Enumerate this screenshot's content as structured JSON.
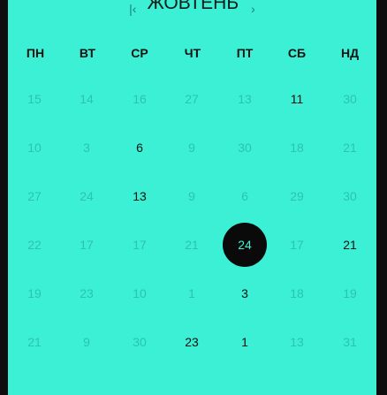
{
  "header": {
    "month_label": "ЖОВТЕНЬ",
    "prev_icon": "chevron-left-icon",
    "next_icon": "chevron-right-icon"
  },
  "weekdays": [
    "ПН",
    "ВТ",
    "СР",
    "ЧТ",
    "ПТ",
    "СБ",
    "НД"
  ],
  "colors": {
    "background": "#3bf0d4",
    "faded_text": "#2cc4ad",
    "marked_text": "#111111",
    "selected_bg": "#0a0a0a"
  },
  "weeks": [
    [
      {
        "d": "15",
        "s": "faded"
      },
      {
        "d": "14",
        "s": "faded"
      },
      {
        "d": "16",
        "s": "faded"
      },
      {
        "d": "27",
        "s": "faded"
      },
      {
        "d": "13",
        "s": "faded"
      },
      {
        "d": "11",
        "s": "marked"
      },
      {
        "d": "30",
        "s": "faded"
      }
    ],
    [
      {
        "d": "10",
        "s": "faded"
      },
      {
        "d": "3",
        "s": "faded"
      },
      {
        "d": "6",
        "s": "marked"
      },
      {
        "d": "9",
        "s": "faded"
      },
      {
        "d": "30",
        "s": "faded"
      },
      {
        "d": "18",
        "s": "faded"
      },
      {
        "d": "21",
        "s": "faded"
      }
    ],
    [
      {
        "d": "27",
        "s": "faded"
      },
      {
        "d": "24",
        "s": "faded"
      },
      {
        "d": "13",
        "s": "marked"
      },
      {
        "d": "9",
        "s": "faded"
      },
      {
        "d": "6",
        "s": "faded"
      },
      {
        "d": "29",
        "s": "faded"
      },
      {
        "d": "30",
        "s": "faded"
      }
    ],
    [
      {
        "d": "22",
        "s": "faded"
      },
      {
        "d": "17",
        "s": "faded"
      },
      {
        "d": "17",
        "s": "faded"
      },
      {
        "d": "21",
        "s": "faded"
      },
      {
        "d": "24",
        "s": "selected"
      },
      {
        "d": "17",
        "s": "faded"
      },
      {
        "d": "21",
        "s": "marked"
      }
    ],
    [
      {
        "d": "19",
        "s": "faded"
      },
      {
        "d": "23",
        "s": "faded"
      },
      {
        "d": "10",
        "s": "faded"
      },
      {
        "d": "1",
        "s": "faded"
      },
      {
        "d": "3",
        "s": "marked"
      },
      {
        "d": "18",
        "s": "faded"
      },
      {
        "d": "19",
        "s": "faded"
      }
    ],
    [
      {
        "d": "21",
        "s": "faded"
      },
      {
        "d": "9",
        "s": "faded"
      },
      {
        "d": "30",
        "s": "faded"
      },
      {
        "d": "23",
        "s": "marked"
      },
      {
        "d": "1",
        "s": "marked"
      },
      {
        "d": "13",
        "s": "faded"
      },
      {
        "d": "31",
        "s": "faded"
      }
    ]
  ]
}
